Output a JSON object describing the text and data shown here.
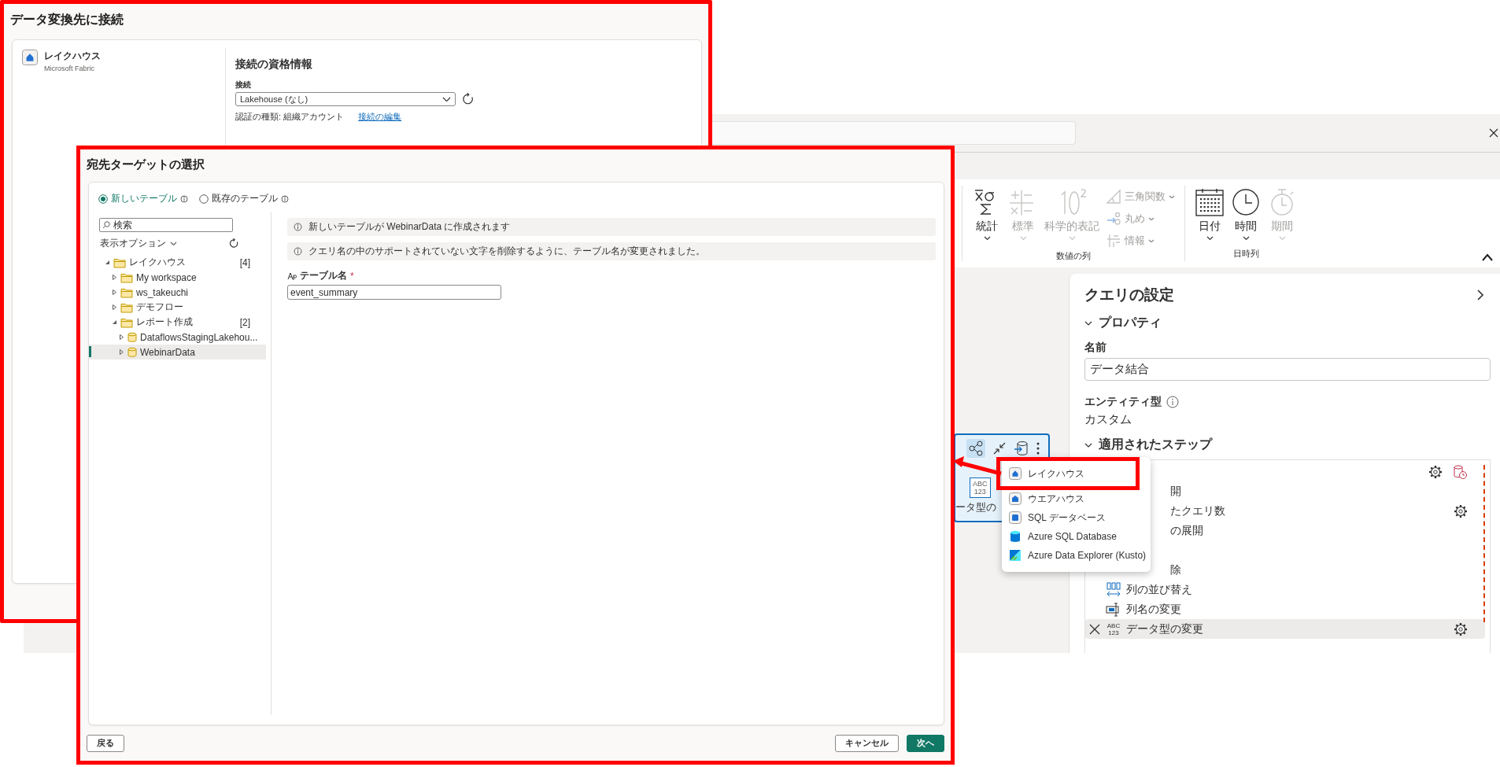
{
  "editor": {
    "ribbon": {
      "groups": [
        {
          "label": "数値の列",
          "items": [
            {
              "kind": "large",
              "label": "統計",
              "disabled": false
            },
            {
              "kind": "large",
              "label": "標準",
              "disabled": true
            },
            {
              "kind": "large",
              "label": "科学的表記",
              "disabled": true
            },
            {
              "kind": "small",
              "label": "三角関数",
              "disabled": true
            },
            {
              "kind": "small",
              "label": "丸め",
              "disabled": true
            },
            {
              "kind": "small",
              "label": "情報",
              "disabled": true
            }
          ]
        },
        {
          "label": "日時列",
          "items": [
            {
              "kind": "large",
              "label": "日付",
              "disabled": false
            },
            {
              "kind": "large",
              "label": "時間",
              "disabled": false
            },
            {
              "kind": "large",
              "label": "期間",
              "disabled": true
            }
          ]
        }
      ]
    },
    "step_card": {
      "type_badge": [
        "ABC",
        "123"
      ],
      "label": "ータ型の"
    },
    "query_settings": {
      "title": "クエリの設定",
      "properties_heading": "プロパティ",
      "name_label": "名前",
      "name_value": "データ結合",
      "entity_label": "エンティティ型",
      "entity_value": "カスタム",
      "steps_heading": "適用されたステップ",
      "steps": [
        {
          "kind": "covered",
          "selected": false,
          "gear": true,
          "destination": true
        },
        {
          "kind": "covered",
          "label": "開",
          "selected": false,
          "gear": false,
          "destination": false
        },
        {
          "kind": "covered",
          "label": "たクエリ数",
          "selected": false,
          "gear": true,
          "destination": false
        },
        {
          "kind": "covered",
          "label": "の展開",
          "selected": false,
          "gear": false,
          "destination": false
        },
        {
          "kind": "covered",
          "selected": false,
          "gear": false,
          "destination": false
        },
        {
          "kind": "covered",
          "label": "除",
          "selected": false,
          "gear": false,
          "destination": false
        },
        {
          "kind": "reorder",
          "label": "列の並び替え",
          "selected": false,
          "gear": false,
          "destination": false
        },
        {
          "kind": "rename",
          "label": "列名の変更",
          "selected": false,
          "gear": false,
          "destination": false
        },
        {
          "kind": "type",
          "type_badge": [
            "ABC",
            "123"
          ],
          "label": "データ型の変更",
          "selected": true,
          "gear": true,
          "destination": false
        }
      ]
    },
    "destination_menu": {
      "items": [
        {
          "kind": "lakehouse",
          "label": "レイクハウス",
          "highlighted": true
        },
        {
          "kind": "warehouse",
          "label": "ウエアハウス",
          "highlighted": false
        },
        {
          "kind": "sql_database",
          "label": "SQL データベース",
          "highlighted": false
        },
        {
          "kind": "azure_sql",
          "label": "Azure SQL Database",
          "highlighted": false
        },
        {
          "kind": "data_explorer",
          "label": "Azure Data Explorer (Kusto)",
          "highlighted": false
        }
      ]
    }
  },
  "connect_dialog": {
    "title": "データ変換先に接続",
    "source": {
      "name": "レイクハウス",
      "provider": "Microsoft Fabric"
    },
    "credentials": {
      "heading": "接続の資格情報",
      "connection_label": "接続",
      "connection_value": "Lakehouse (なし)",
      "auth_text": "認証の種類: 組織アカウント",
      "edit_link": "接続の編集"
    }
  },
  "target_dialog": {
    "title": "宛先ターゲットの選択",
    "options": [
      {
        "label": "新しいテーブル",
        "selected": true
      },
      {
        "label": "既存のテーブル",
        "selected": false
      }
    ],
    "search": {
      "placeholder": "検索"
    },
    "view_options": "表示オプション",
    "tree": [
      {
        "kind": "folder",
        "label": "レイクハウス",
        "count": "[4]",
        "expanded": true,
        "selected": false,
        "children": [
          {
            "kind": "folder",
            "label": "My workspace",
            "expanded": false,
            "selected": false
          },
          {
            "kind": "folder",
            "label": "ws_takeuchi",
            "expanded": false,
            "selected": false
          },
          {
            "kind": "folder",
            "label": "デモフロー",
            "expanded": false,
            "selected": false
          },
          {
            "kind": "folder",
            "label": "レポート作成",
            "count": "[2]",
            "expanded": true,
            "selected": false,
            "children": [
              {
                "kind": "lakehouse",
                "label": "DataflowsStagingLakehou...",
                "expanded": false,
                "selected": false
              },
              {
                "kind": "lakehouse",
                "label": "WebinarData",
                "expanded": false,
                "selected": true
              }
            ]
          }
        ]
      }
    ],
    "messages": [
      "新しいテーブルが WebinarData に作成されます",
      "クエリ名の中のサポートされていない文字を削除するように、テーブル名が変更されました。"
    ],
    "table_name": {
      "label": "テーブル名",
      "required_mark": "*",
      "value": "event_summary"
    },
    "buttons": {
      "back": "戻る",
      "cancel": "キャンセル",
      "next": "次へ"
    }
  }
}
